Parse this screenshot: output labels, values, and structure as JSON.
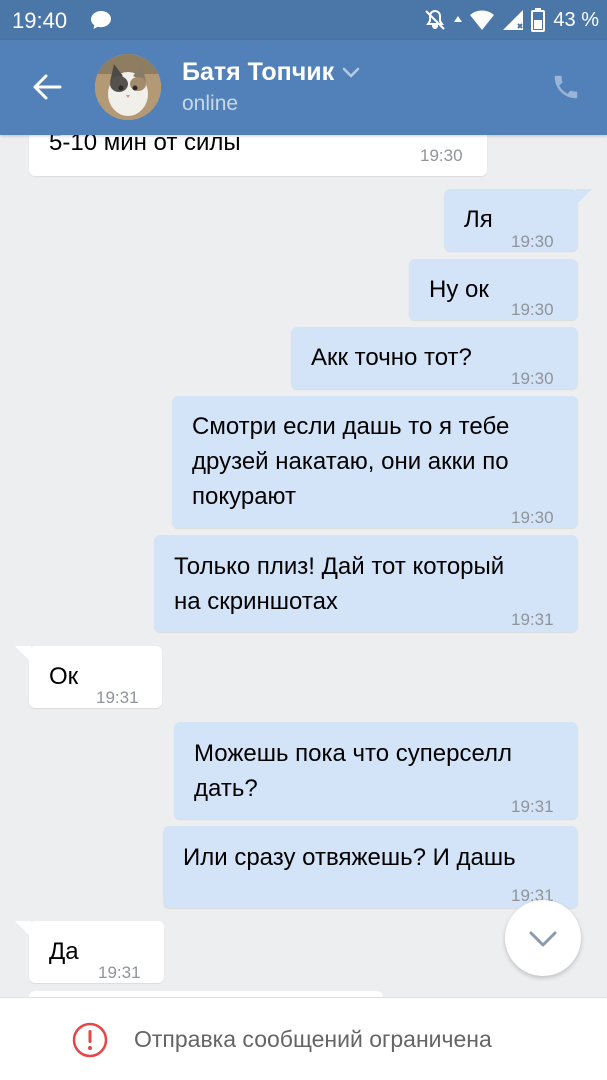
{
  "statusbar": {
    "time": "19:40",
    "battery": "43 %",
    "icons": [
      "chat-bubble-icon",
      "mute-icon",
      "wifi-icon",
      "signal-icon",
      "battery-icon"
    ]
  },
  "header": {
    "name": "Батя Топчик",
    "status": "online",
    "icons": [
      "back-arrow-icon",
      "chevron-down-icon",
      "phone-icon"
    ]
  },
  "messages": [
    {
      "dir": "in",
      "text": "5-10 мин от силы",
      "time": "19:30"
    },
    {
      "dir": "out",
      "text": "Ля",
      "time": "19:30"
    },
    {
      "dir": "out",
      "text": "Ну ок",
      "time": "19:30"
    },
    {
      "dir": "out",
      "text": "Акк точно тот?",
      "time": "19:30"
    },
    {
      "dir": "out",
      "lines": [
        "Смотри если дашь то я тебе",
        "друзей накатаю, они акки по",
        "покурают"
      ],
      "time": "19:30"
    },
    {
      "dir": "out",
      "lines": [
        "Только плиз! Дай тот который",
        "на скриншотах"
      ],
      "time": "19:31"
    },
    {
      "dir": "in",
      "text": "Ок",
      "time": "19:31"
    },
    {
      "dir": "out",
      "lines": [
        "Можешь пока что суперселл",
        "дать?"
      ],
      "time": "19:31"
    },
    {
      "dir": "out",
      "text": "Или сразу отвяжешь? И дашь",
      "time": "19:31"
    },
    {
      "dir": "in",
      "text": "Да",
      "time": "19:31"
    }
  ],
  "footer": {
    "restriction": "Отправка сообщений ограничена",
    "icon": "warning-icon"
  },
  "colors": {
    "header": "#5181b8",
    "statusbar": "#4a76a8",
    "background": "#edeef0",
    "outgoing": "#d4e4f8",
    "incoming": "#ffffff",
    "warning": "#e64646"
  }
}
